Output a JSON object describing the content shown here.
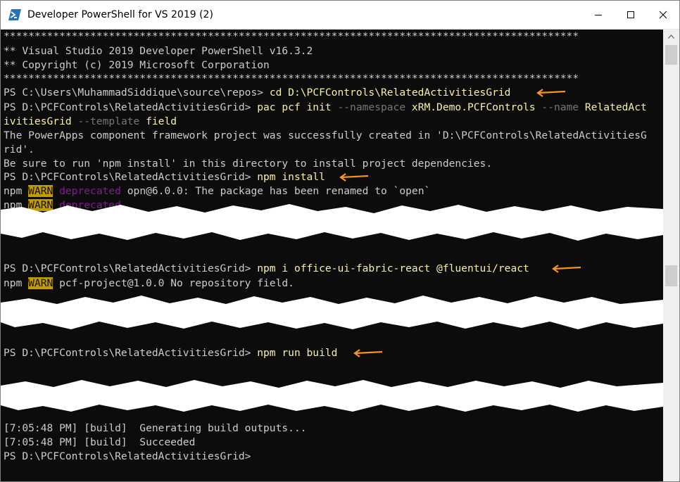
{
  "window": {
    "title": "Developer PowerShell for VS 2019 (2)"
  },
  "colors": {
    "console_bg": "#0c0c0c",
    "text": "#cccccc",
    "command": "#f9f1a5",
    "parameter": "#767676",
    "warn_bg": "#c19c00",
    "deprecated": "#881798",
    "annotation_arrow": "#f7931e"
  },
  "console": {
    "banner_stars": "*********************************************************************************************",
    "banner_line1": "** Visual Studio 2019 Developer PowerShell v16.3.2",
    "banner_line2": "** Copyright (c) 2019 Microsoft Corporation",
    "prompt_home": "PS C:\\Users\\MuhammadSiddique\\source\\repos> ",
    "prompt_project": "PS D:\\PCFControls\\RelatedActivitiesGrid> ",
    "cmd_cd": "cd D:\\PCFControls\\RelatedActivitiesGrid",
    "cmd_pac": "pac pcf init ",
    "pac_namespace_flag": "--namespace",
    "pac_namespace_value": " xRM.Demo.PCFControls ",
    "pac_name_flag": "--name",
    "pac_name_value": " RelatedAct",
    "pac_wrap_value": "ivitiesGrid ",
    "pac_template_flag": "--template",
    "pac_template_value": " field",
    "success_line1": "The PowerApps component framework project was successfully created in 'D:\\PCFControls\\RelatedActivitiesG",
    "success_line2": "rid'.",
    "hint_line": "Be sure to run 'npm install' in this directory to install project dependencies.",
    "cmd_npm_install": "npm install",
    "npm_prefix": "npm ",
    "warn_label": "WARN",
    "deprecated_label": "deprecated",
    "warn_opn": " opn@6.0.0: The package has been renamed to `open`",
    "cmd_npm_fabric": "npm i office-ui-fabric-react @fluentui/react",
    "warn_repo": " pcf-project@1.0.0 No repository field.",
    "cmd_npm_build": "npm run build",
    "build_out1": "[7:05:48 PM] [build]  Generating build outputs...",
    "build_out2": "[7:05:48 PM] [build]  Succeeded",
    "final_prompt": "PS D:\\PCFControls\\RelatedActivitiesGrid>"
  }
}
